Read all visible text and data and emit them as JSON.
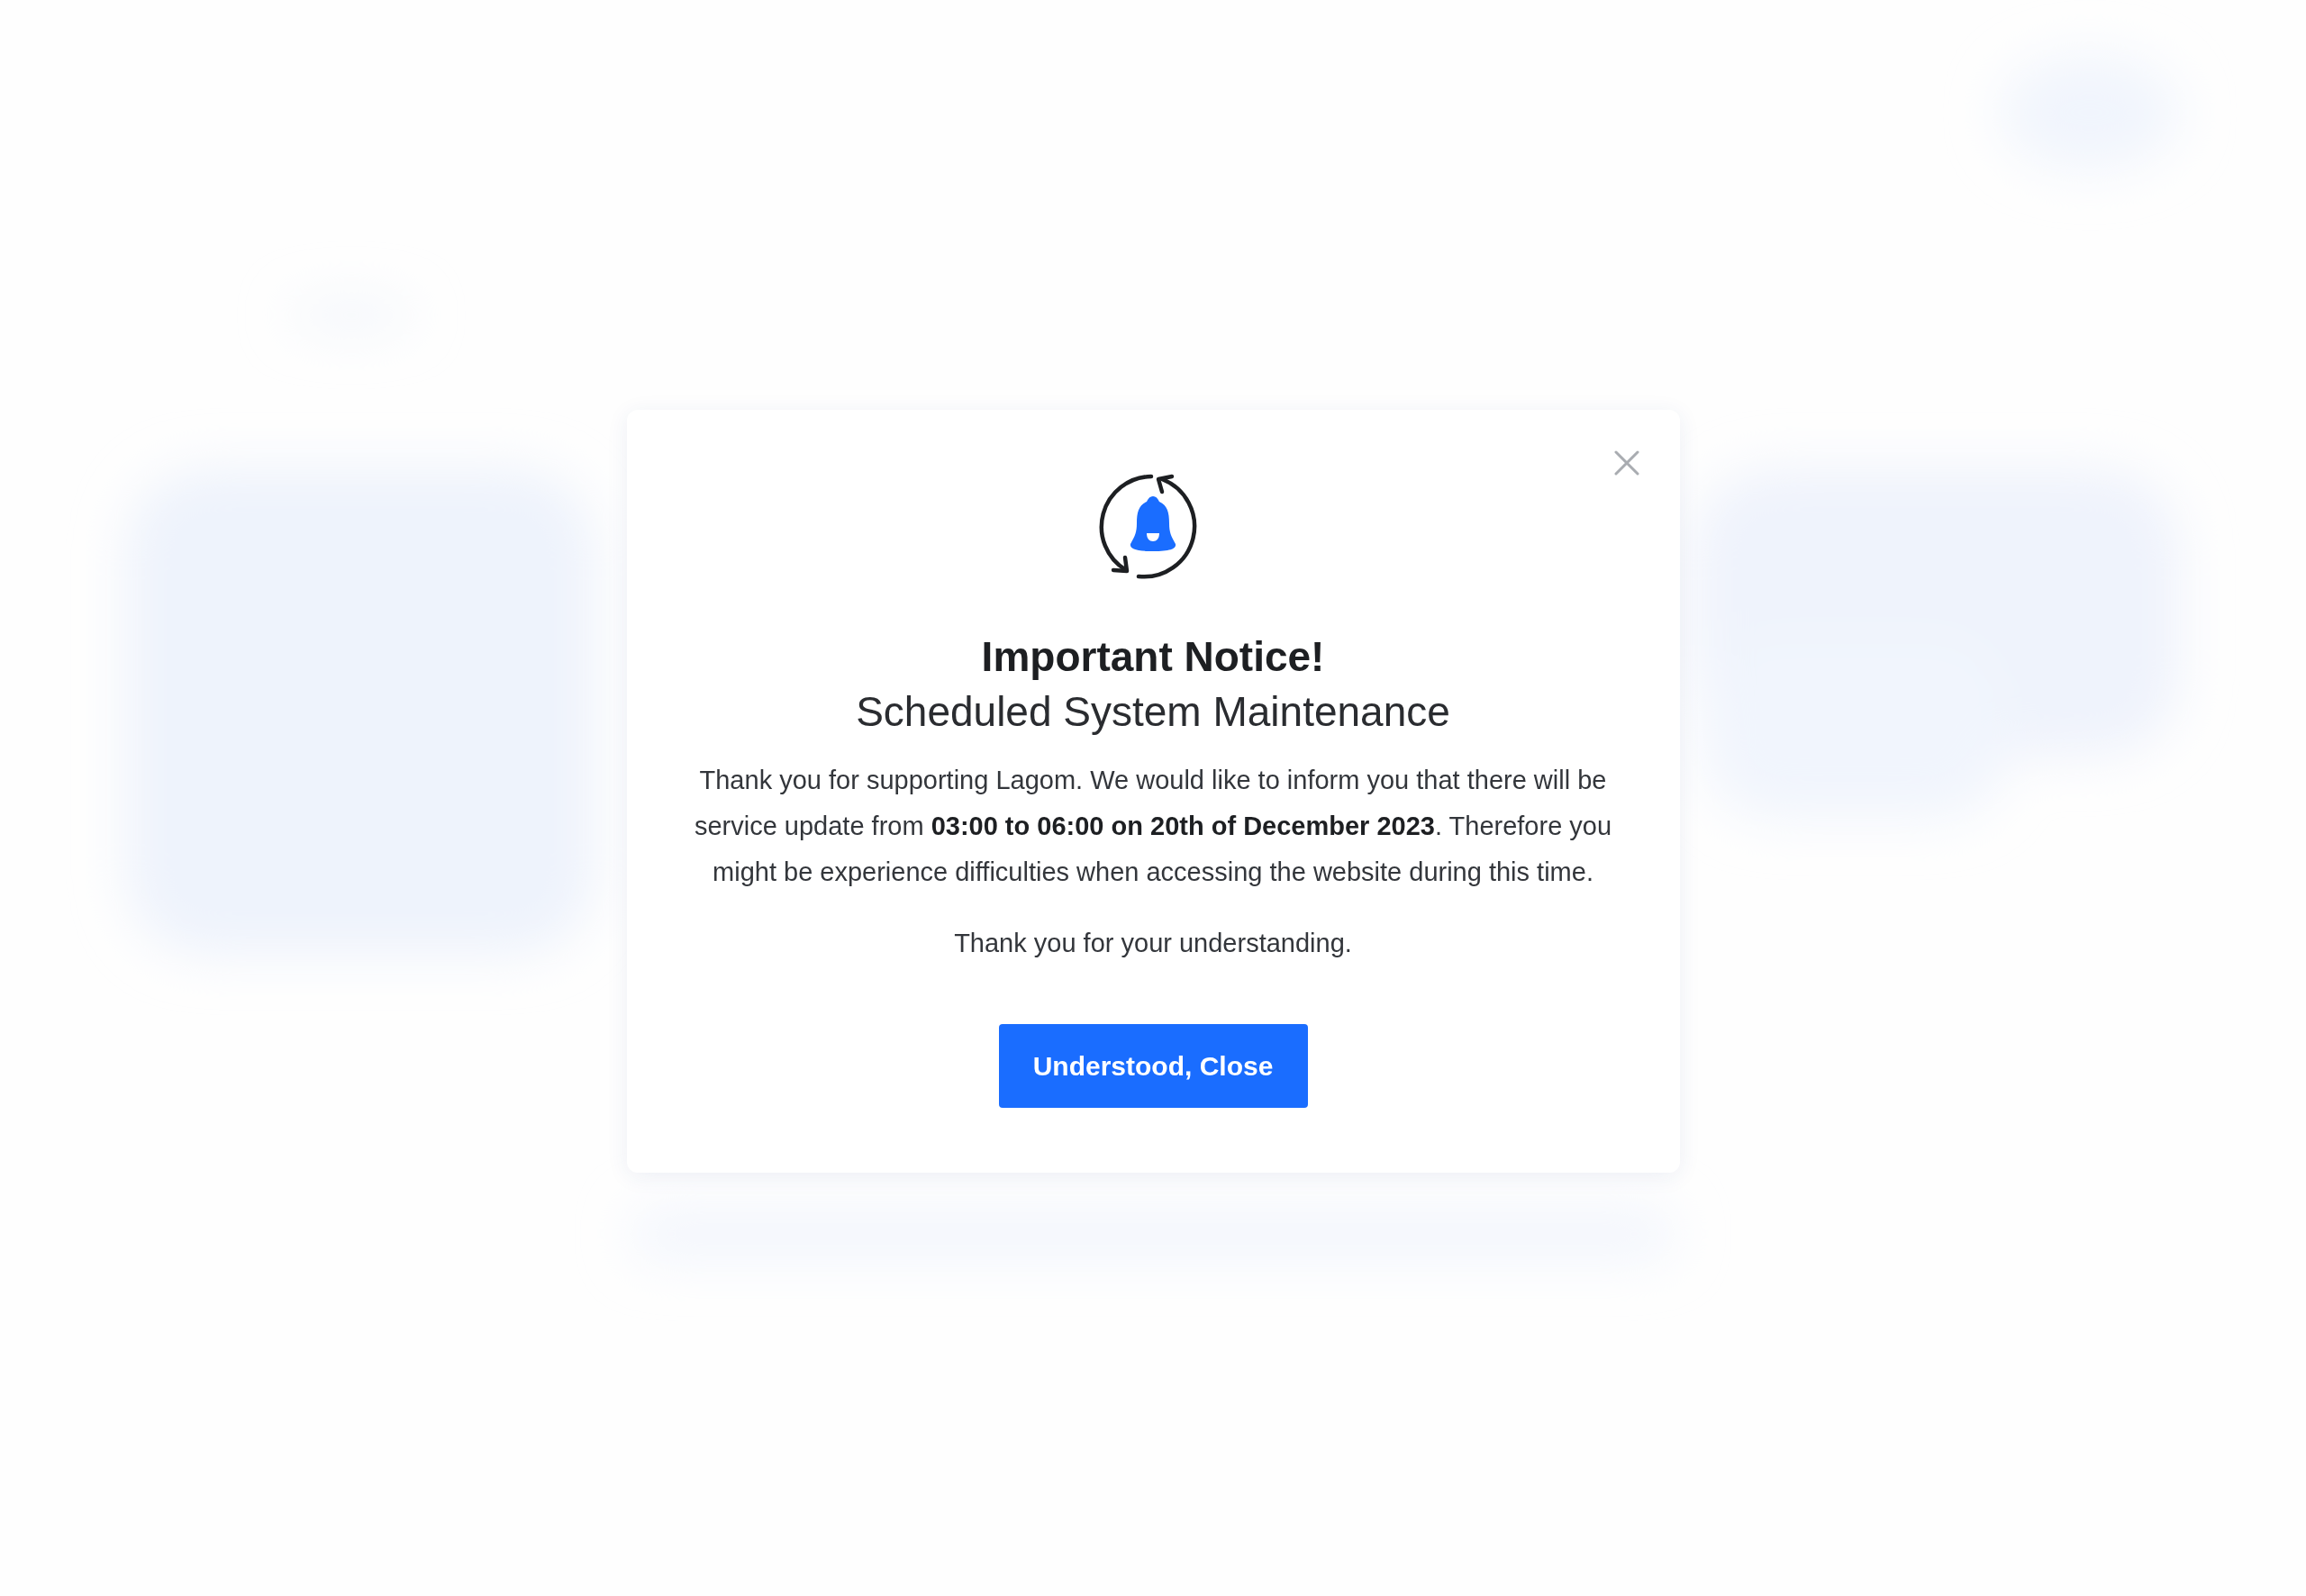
{
  "dialog": {
    "title": "Important Notice!",
    "subtitle": "Scheduled System Maintenance",
    "paragraphs": [
      "Thank you for supporting Lagom. We would like to inform you that there will be service update from **03:00 to 06:00 on 20th of December 2023**. Therefore you might be experience  difficulties when accessing the website during this time.",
      "Thank you for your understanding."
    ],
    "button": "Understood, Close"
  }
}
